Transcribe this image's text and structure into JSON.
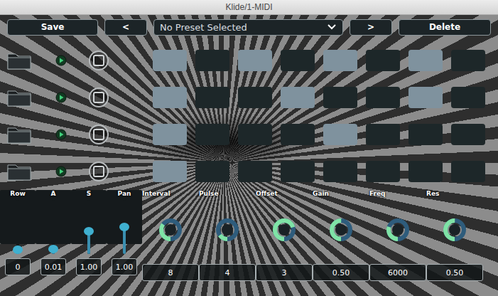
{
  "window": {
    "title": "Klide/1-MIDI"
  },
  "toolbar": {
    "save": "Save",
    "prev": "<",
    "preset": "No Preset Selected",
    "next": ">",
    "delete": "Delete"
  },
  "tracks": [
    {
      "checked": false,
      "steps": [
        true,
        false,
        true,
        false,
        true,
        false,
        true,
        false
      ]
    },
    {
      "checked": false,
      "steps": [
        true,
        false,
        false,
        true,
        false,
        false,
        true,
        false
      ]
    },
    {
      "checked": false,
      "steps": [
        true,
        false,
        false,
        false,
        true,
        false,
        false,
        false
      ]
    },
    {
      "checked": false,
      "steps": [
        true,
        false,
        false,
        false,
        false,
        false,
        false,
        false
      ]
    }
  ],
  "controls": [
    {
      "label": "Row",
      "kind": "slider",
      "level": 0,
      "value": "0"
    },
    {
      "label": "A",
      "kind": "slider",
      "level": 0.01,
      "value": "0.01"
    },
    {
      "label": "S",
      "kind": "slider",
      "level": 0.4,
      "value": "1.00"
    },
    {
      "label": "Pan",
      "kind": "slider",
      "level": 0.5,
      "value": "1.00"
    },
    {
      "label": "Interval",
      "kind": "knob",
      "level": 0.35,
      "value": "8"
    },
    {
      "label": "Pulse",
      "kind": "knob",
      "level": 0.15,
      "value": "4"
    },
    {
      "label": "Offset",
      "kind": "knob",
      "level": 0.7,
      "value": "3"
    },
    {
      "label": "Gain",
      "kind": "knob",
      "level": 0.5,
      "value": "0.50"
    },
    {
      "label": "Freq",
      "kind": "knob",
      "level": 0.3,
      "value": "6000"
    },
    {
      "label": "Res",
      "kind": "knob",
      "level": 0.5,
      "value": "0.50"
    }
  ]
}
